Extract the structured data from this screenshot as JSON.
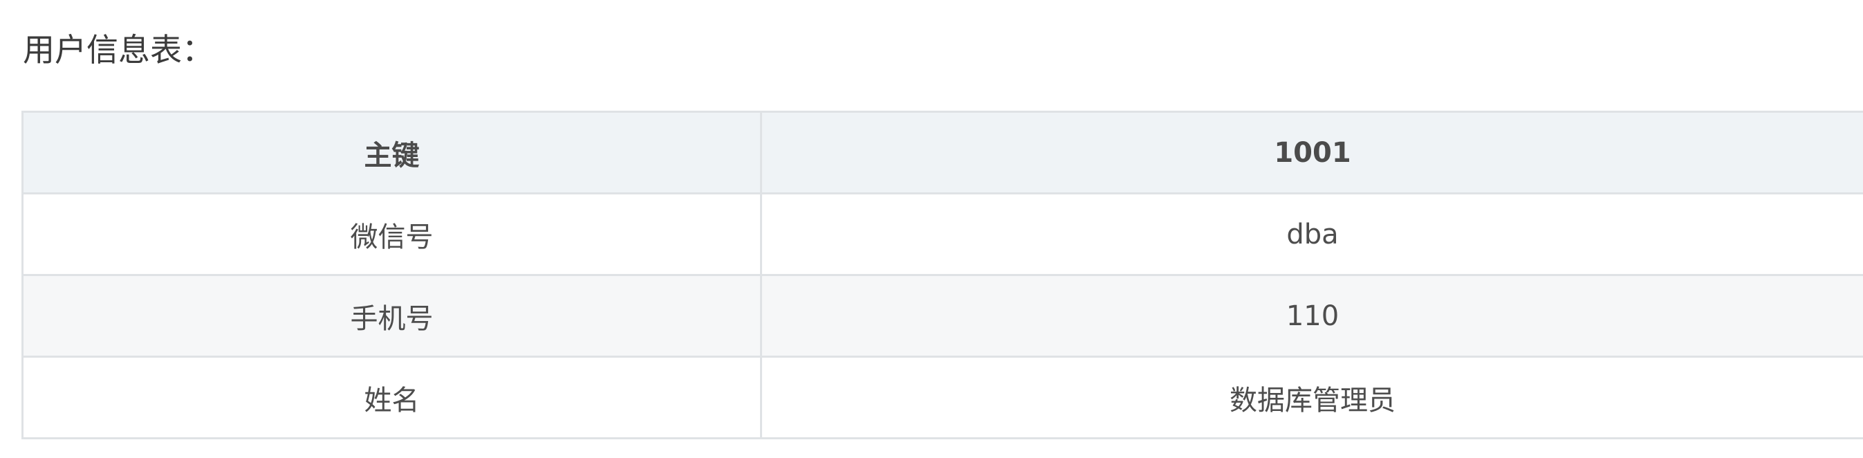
{
  "heading": "用户信息表：",
  "table": {
    "header": {
      "key": "主键",
      "value": "1001"
    },
    "rows": [
      {
        "key": "微信号",
        "value": "dba"
      },
      {
        "key": "手机号",
        "value": "110"
      },
      {
        "key": "姓名",
        "value": "数据库管理员"
      }
    ]
  },
  "colors": {
    "header_bg": "#eff3f6",
    "alt_row_bg": "#f6f7f8",
    "border": "#dfe2e5",
    "text": "#4d4d4d"
  }
}
